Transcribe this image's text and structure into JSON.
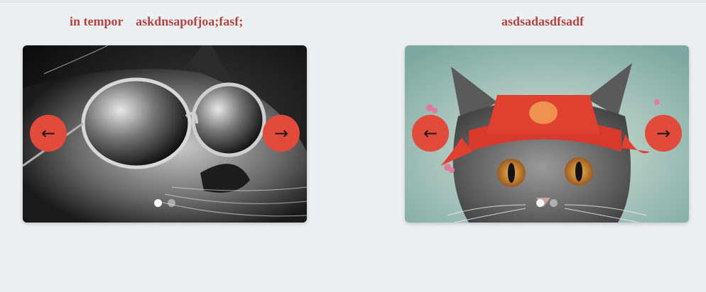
{
  "titles": {
    "left": "in tempor    askdnsapofjoa;fasf;",
    "right": "asdsadasdfsadf"
  },
  "carousels": [
    {
      "image_icon": "cat-with-sunglasses-photo",
      "prev_label": "←",
      "next_label": "→",
      "dots": 2,
      "active_dot": 0
    },
    {
      "image_icon": "cat-with-red-hat-illustration",
      "prev_label": "←",
      "next_label": "→",
      "dots": 2,
      "active_dot": 0
    }
  ],
  "colors": {
    "title": "#b04444",
    "arrow_bg": "#e24a3c",
    "page_bg": "#eceff0"
  }
}
